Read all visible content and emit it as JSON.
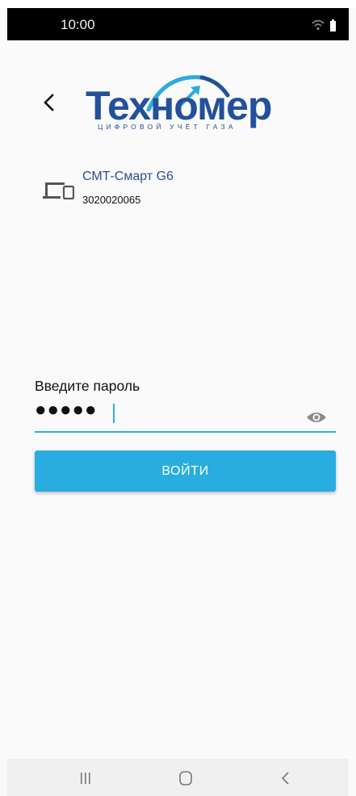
{
  "status_bar": {
    "time": "10:00",
    "icons": [
      "wifi-icon",
      "battery-icon"
    ]
  },
  "header": {
    "back_icon": "chevron-left-icon",
    "logo_text": "Техномер",
    "logo_tagline": "ЦИФРОВОЙ УЧЁТ ГАЗА"
  },
  "device": {
    "icon": "devices-icon",
    "name": "СМТ-Смарт G6",
    "serial": "3020020065"
  },
  "login_form": {
    "password_label": "Введите пароль",
    "password_value": "●●●●●",
    "visibility_icon": "eye-icon",
    "login_button": "ВОЙТИ"
  },
  "nav_bar": {
    "buttons": [
      "recent-apps-icon",
      "home-icon",
      "back-icon"
    ]
  },
  "colors": {
    "accent": "#29ade0",
    "brand": "#23509b",
    "device_name": "#2a4f8f",
    "underline": "#29b1dd"
  }
}
